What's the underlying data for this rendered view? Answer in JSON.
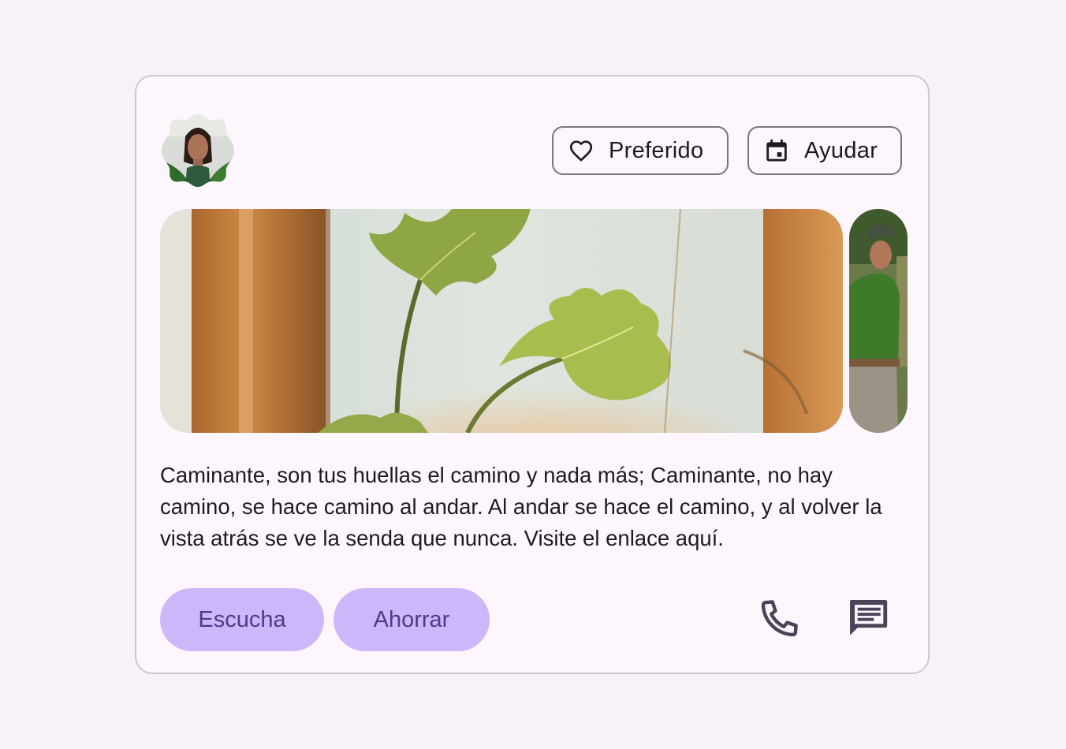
{
  "actions": {
    "favorite_label": "Preferido",
    "help_label": "Ayudar"
  },
  "body_text": "Caminante, son tus huellas el camino y nada más; Caminante, no hay camino, se hace camino al andar. Al andar se hace el camino, y al volver la vista atrás se ve la senda que nunca. Visite el enlace aquí.",
  "footer": {
    "listen_label": "Escucha",
    "save_label": "Ahorrar"
  },
  "icons": {
    "favorite": "heart-outline-icon",
    "help": "calendar-icon",
    "phone": "phone-icon",
    "chat": "chat-icon"
  },
  "colors": {
    "background": "#f7f2f9",
    "card": "#fdf7fd",
    "outline": "#79747e",
    "tonal_button": "#cbb8fb",
    "tonal_text": "#4d3a8a",
    "icon": "#4a4458"
  }
}
